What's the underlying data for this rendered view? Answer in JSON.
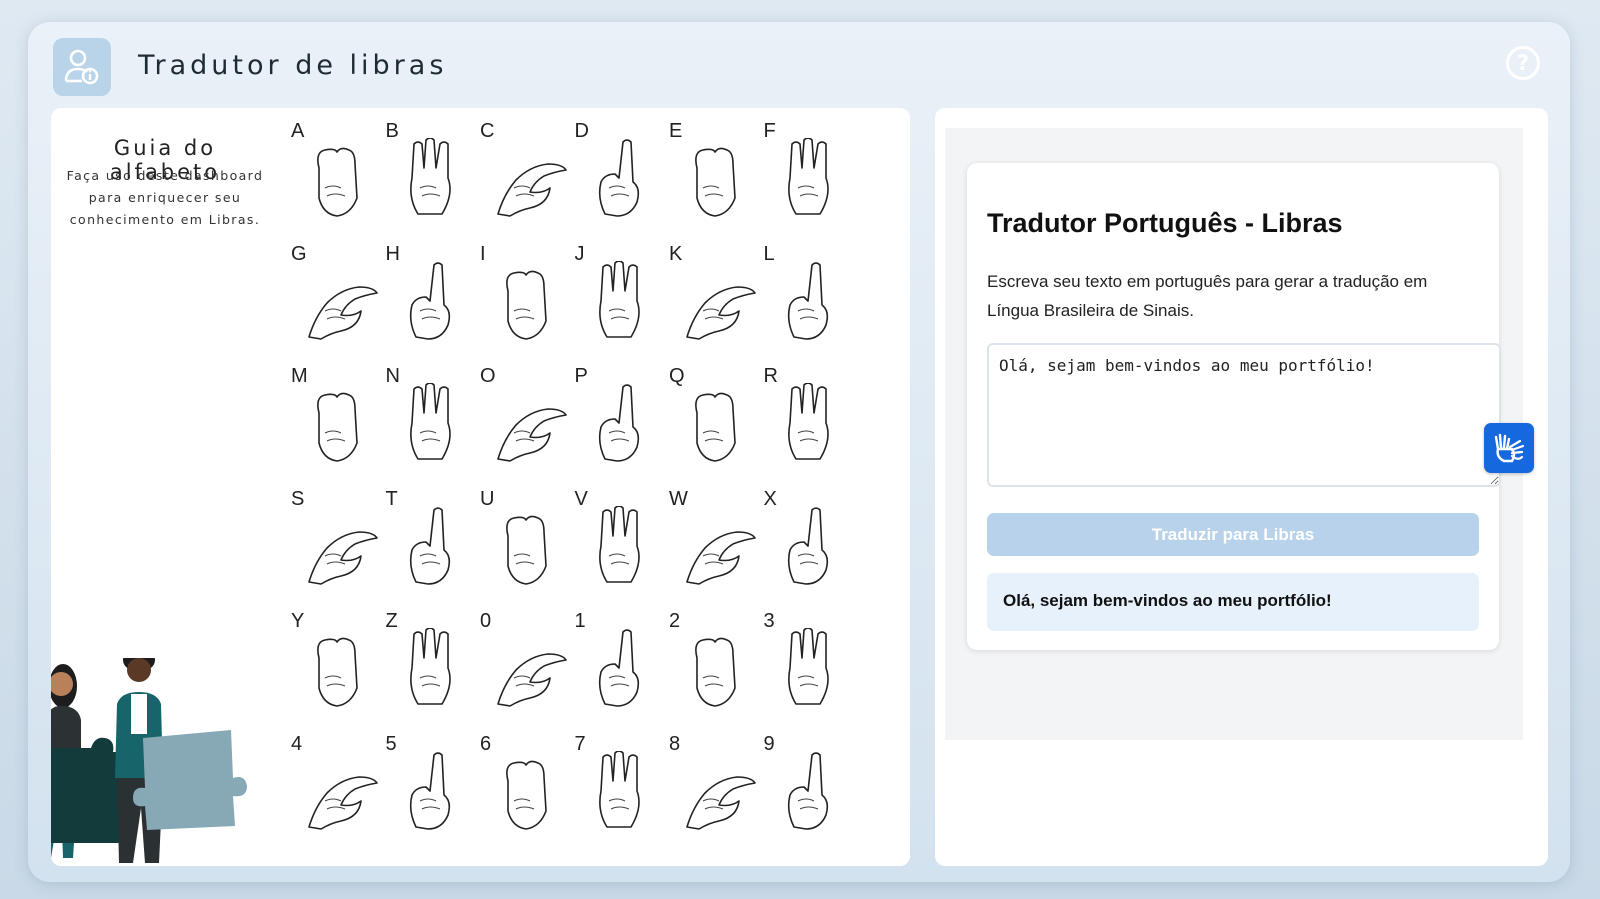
{
  "header": {
    "title": "Tradutor de libras",
    "help_symbol": "?",
    "logo_icon": "user-info-icon"
  },
  "guide": {
    "title": "Guia do alfabeto",
    "subtitle_lines": [
      "Faça uso deste dashboard",
      "para enriquecer seu",
      "conhecimento em Libras."
    ],
    "letters": [
      "A",
      "B",
      "C",
      "D",
      "E",
      "F",
      "G",
      "H",
      "I",
      "J",
      "K",
      "L",
      "M",
      "N",
      "O",
      "P",
      "Q",
      "R",
      "S",
      "T",
      "U",
      "V",
      "W",
      "X",
      "Y",
      "Z",
      "0",
      "1",
      "2",
      "3",
      "4",
      "5",
      "6",
      "7",
      "8",
      "9"
    ]
  },
  "translator": {
    "title": "Tradutor Português - Libras",
    "description": "Escreva seu texto em português para gerar a tradução em Língua Brasileira de Sinais.",
    "input_value": "Olá, sejam bem-vindos ao meu portfólio!",
    "translate_button": "Traduzir para Libras",
    "output_text": "Olá, sejam bem-vindos ao meu portfólio!",
    "accent_color": "#1668df",
    "button_color": "#b7d2ea"
  }
}
